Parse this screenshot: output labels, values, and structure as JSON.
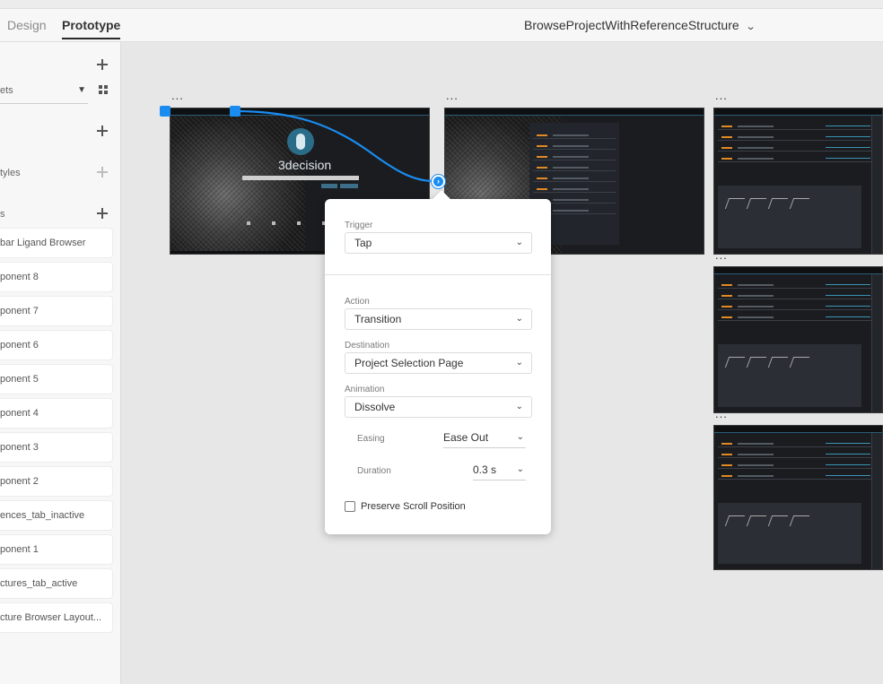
{
  "toolbar": {
    "tabs": [
      {
        "label": "Design"
      },
      {
        "label": "Prototype"
      }
    ],
    "document_title": "BrowseProjectWithReferenceStructure"
  },
  "assets_panel": {
    "filter_text": "ets",
    "sections": [
      {
        "label": "tyles"
      },
      {
        "label": "s"
      }
    ],
    "components": [
      "bar Ligand Browser",
      "ponent 8",
      "ponent 7",
      "ponent 6",
      "ponent 5",
      "ponent 4",
      "ponent 3",
      "ponent 2",
      "ences_tab_inactive",
      "ponent 1",
      "ctures_tab_active",
      "cture Browser Layout..."
    ]
  },
  "canvas": {
    "artboard_label": "...",
    "logo_text": "3decision",
    "connector_color": "#1a8cf0"
  },
  "interaction": {
    "trigger": {
      "label": "Trigger",
      "value": "Tap"
    },
    "action": {
      "label": "Action",
      "value": "Transition"
    },
    "destination": {
      "label": "Destination",
      "value": "Project Selection Page"
    },
    "animation": {
      "label": "Animation",
      "value": "Dissolve"
    },
    "easing": {
      "label": "Easing",
      "value": "Ease Out"
    },
    "duration": {
      "label": "Duration",
      "value": "0.3 s"
    },
    "preserve_scroll": {
      "label": "Preserve Scroll Position",
      "checked": false
    }
  }
}
